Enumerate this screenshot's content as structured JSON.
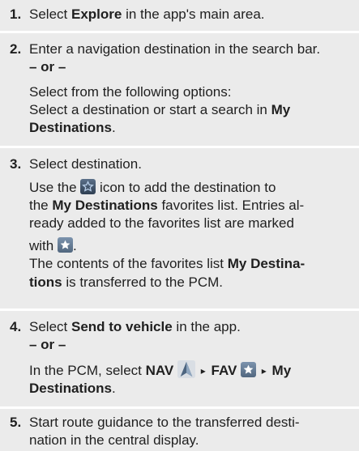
{
  "colors": {
    "step_background": "#ebebeb",
    "text": "#1f1f1f",
    "icon_dark": "#3f5268",
    "icon_light": "#6d849e"
  },
  "steps": [
    {
      "number": "1.",
      "select": "Select ",
      "explore": "Explore",
      "tail": " in the app's main area."
    },
    {
      "number": "2.",
      "line1": "Enter a navigation destination in the search bar.",
      "or": "– or –",
      "line3": "Select from the following options:",
      "line4a": "Select a destination or start a search in ",
      "line4b": "My",
      "line5a": "Destinations",
      "line5b": "."
    },
    {
      "number": "3.",
      "line1": "Select destination.",
      "line2a": "Use the ",
      "line2b": " icon to add the destination to",
      "line3a": "the ",
      "line3b": "My Destinations",
      "line3c": " favorites list. Entries al-",
      "line4": "ready added to the favorites list are marked",
      "line5a": "with ",
      "line5b": ".",
      "line6a": "The contents of the favorites list ",
      "line6b": "My Destina-",
      "line7a": "tions",
      "line7b": " is transferred to the PCM.",
      "icon_add": "star-outline-icon",
      "icon_marked": "star-filled-icon"
    },
    {
      "number": "4.",
      "line1a": "Select ",
      "line1b": "Send to vehicle",
      "line1c": " in the app.",
      "or": "– or –",
      "line3a": "In the PCM, select ",
      "nav": "NAV",
      "arrow1": "▸",
      "fav": "FAV",
      "arrow2": "▸",
      "line3b": "My",
      "line4a": "Destinations",
      "line4b": ".",
      "icon_nav": "navigation-arrow-icon",
      "icon_fav": "star-filled-icon"
    },
    {
      "number": "5.",
      "line1": "Start route guidance to the transferred desti-",
      "line2": "nation in the central display."
    }
  ]
}
